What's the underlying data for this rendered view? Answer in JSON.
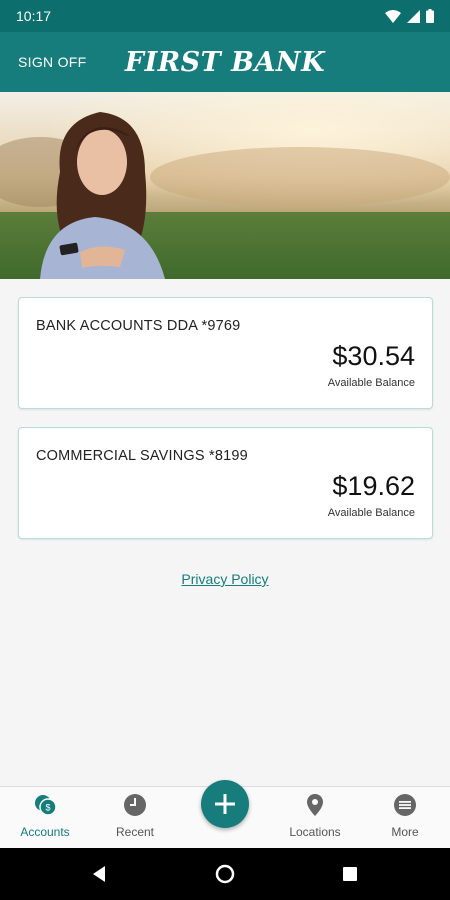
{
  "status_bar": {
    "time": "10:17",
    "icons": [
      "wifi-icon",
      "signal-icon",
      "battery-icon"
    ]
  },
  "header": {
    "sign_off_label": "SIGN OFF",
    "brand": "FIRST BANK"
  },
  "hero": {
    "image": "woman-texting-photo"
  },
  "accounts": [
    {
      "name": "BANK ACCOUNTS DDA *9769",
      "balance": "$30.54",
      "balance_label": "Available Balance"
    },
    {
      "name": "COMMERCIAL SAVINGS *8199",
      "balance": "$19.62",
      "balance_label": "Available Balance"
    }
  ],
  "privacy_link": "Privacy Policy",
  "bottom_nav": {
    "items": [
      {
        "label": "Accounts",
        "icon": "accounts-icon",
        "active": true
      },
      {
        "label": "Recent",
        "icon": "clock-icon",
        "active": false
      },
      {
        "label": "Locations",
        "icon": "location-pin-icon",
        "active": false
      },
      {
        "label": "More",
        "icon": "more-icon",
        "active": false
      }
    ],
    "fab_icon": "plus-icon"
  },
  "system_nav": [
    "back-icon",
    "home-icon",
    "recents-icon"
  ],
  "colors": {
    "primary": "#167c7c",
    "status_bar": "#0d6e6e",
    "card_border": "#b8dcd8",
    "background": "#f5f5f5"
  }
}
